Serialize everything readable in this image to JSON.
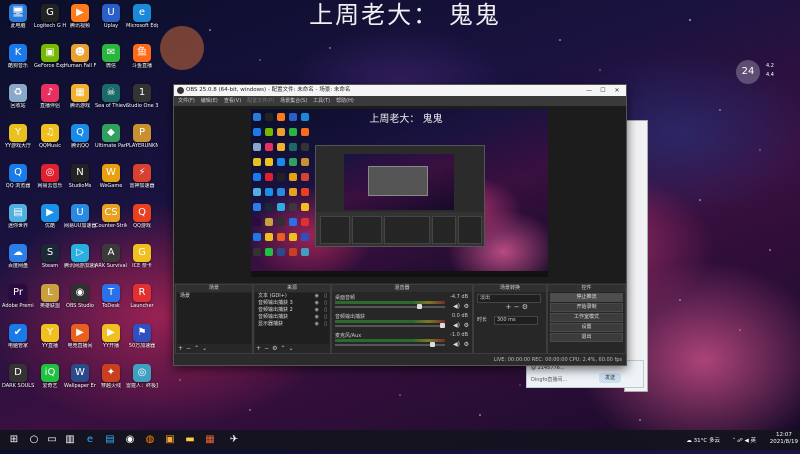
{
  "wallpaper_title": "上周老大： 鬼鬼",
  "desktop_icons": [
    {
      "label": "此电脑",
      "color": "#2a7ad8",
      "glyph": "🖥"
    },
    {
      "label": "Logitech G HUB",
      "color": "#222",
      "glyph": "G"
    },
    {
      "label": "腾讯视频",
      "color": "#ff7a1a",
      "glyph": "▶"
    },
    {
      "label": "Uplay",
      "color": "#2a5fc8",
      "glyph": "U"
    },
    {
      "label": "Microsoft Edge",
      "color": "#1a8ad8",
      "glyph": "e"
    },
    {
      "label": "酷狗音乐",
      "color": "#1a7ae8",
      "glyph": "K"
    },
    {
      "label": "GeForce Experience",
      "color": "#76b900",
      "glyph": "▣"
    },
    {
      "label": "Human Fall Flat",
      "color": "#e8a030",
      "glyph": "☻"
    },
    {
      "label": "微信",
      "color": "#2ab540",
      "glyph": "✉"
    },
    {
      "label": "斗鱼直播",
      "color": "#ff6a1a",
      "glyph": "鱼"
    },
    {
      "label": "回收站",
      "color": "#8aa8c8",
      "glyph": "♻"
    },
    {
      "label": "直播伴侣",
      "color": "#e83060",
      "glyph": "♪"
    },
    {
      "label": "腾讯游戏",
      "color": "#f0b030",
      "glyph": "▦"
    },
    {
      "label": "Sea of Thieves",
      "color": "#1a6a6a",
      "glyph": "☠"
    },
    {
      "label": "Studio One 3",
      "color": "#333",
      "glyph": "1"
    },
    {
      "label": "YY游戏大厅",
      "color": "#e8c020",
      "glyph": "Y"
    },
    {
      "label": "QQMusic",
      "color": "#f0c020",
      "glyph": "♫"
    },
    {
      "label": "腾讯QQ",
      "color": "#1a8ae8",
      "glyph": "Q"
    },
    {
      "label": "Ultimate Party",
      "color": "#30a060",
      "glyph": "◆"
    },
    {
      "label": "PLAYERUNKNOWN'S BATTLEGROUNDS",
      "color": "#c89030",
      "glyph": "P"
    },
    {
      "label": "QQ 浏览器",
      "color": "#1a7ae8",
      "glyph": "Q"
    },
    {
      "label": "网易云音乐",
      "color": "#e02030",
      "glyph": "◎"
    },
    {
      "label": "StudioMs",
      "color": "#222",
      "glyph": "N"
    },
    {
      "label": "WeGame",
      "color": "#e8a010",
      "glyph": "W"
    },
    {
      "label": "雷神加速器",
      "color": "#d84030",
      "glyph": "⚡"
    },
    {
      "label": "迷你世界",
      "color": "#50b0e0",
      "glyph": "▤"
    },
    {
      "label": "优酷",
      "color": "#1a90e8",
      "glyph": "▶"
    },
    {
      "label": "网易UU加速器",
      "color": "#2a8ae0",
      "glyph": "U"
    },
    {
      "label": "Counter-Strike Global Off",
      "color": "#e8a020",
      "glyph": "CS"
    },
    {
      "label": "QQ游戏",
      "color": "#e84020",
      "glyph": "Q"
    },
    {
      "label": "百度网盘",
      "color": "#2a80e8",
      "glyph": "☁"
    },
    {
      "label": "Steam",
      "color": "#1b2838",
      "glyph": "S"
    },
    {
      "label": "腾讯网游加速器",
      "color": "#2ab0e0",
      "glyph": "▷"
    },
    {
      "label": "ARK Survival Evolve",
      "color": "#3a3a3a",
      "glyph": "A"
    },
    {
      "label": "ICE 奈卡",
      "color": "#f0c020",
      "glyph": "G"
    },
    {
      "label": "Adobe Premiere",
      "color": "#2a0a40",
      "glyph": "Pr"
    },
    {
      "label": "英雄联盟",
      "color": "#c8a040",
      "glyph": "L"
    },
    {
      "label": "OBS Studio",
      "color": "#303030",
      "glyph": "◉"
    },
    {
      "label": "ToDesk",
      "color": "#2a70e8",
      "glyph": "T"
    },
    {
      "label": "Launcher",
      "color": "#e03030",
      "glyph": "R"
    },
    {
      "label": "电脑管家",
      "color": "#1a7ae8",
      "glyph": "✔"
    },
    {
      "label": "YY直播",
      "color": "#f0c020",
      "glyph": "Y"
    },
    {
      "label": "电竞直播间",
      "color": "#e86020",
      "glyph": "▶"
    },
    {
      "label": "YY开播",
      "color": "#f0c020",
      "glyph": "▶"
    },
    {
      "label": "50万加速器",
      "color": "#3050c0",
      "glyph": "⚑"
    },
    {
      "label": "DARK SOULS III",
      "color": "#333",
      "glyph": "D"
    },
    {
      "label": "爱奇艺",
      "color": "#20c040",
      "glyph": "iQ"
    },
    {
      "label": "Wallpaper Engine",
      "color": "#2a4a8a",
      "glyph": "W"
    },
    {
      "label": "穿越火线",
      "color": "#c84020",
      "glyph": "✦"
    },
    {
      "label": "雷霆人：终极直播",
      "color": "#40a0c0",
      "glyph": "◎"
    }
  ],
  "weather": {
    "temp": "24",
    "line1": "4.2",
    "line2": "4.4"
  },
  "chat_window": {
    "line1": "@ 2145776...",
    "line2": "Dingfo直播间...",
    "button": "发送"
  },
  "obs": {
    "title": "OBS 25.0.8 (64-bit, windows) - 配置文件: 未命名 - 场景: 未命名",
    "win_min": "—",
    "win_max": "☐",
    "win_close": "✕",
    "menu": [
      "文件(F)",
      "编辑(E)",
      "查看(V)",
      "配置文件(P)",
      "场景集合(S)",
      "工具(T)",
      "帮助(H)"
    ],
    "preview_title": "上周老大： 鬼鬼",
    "docks": {
      "scenes": {
        "header": "场景",
        "items": [
          "场景"
        ]
      },
      "sources": {
        "header": "来源",
        "items": [
          "文本 (GDI+)",
          "音频输出捕获 3",
          "音频输出捕获 2",
          "音频输出捕获",
          "显示器捕获"
        ]
      },
      "mixer": {
        "header": "混音器",
        "rows": [
          {
            "name": "桌面音频",
            "db": "-4.7 dB",
            "level": 0.78
          },
          {
            "name": "音频输出捕获",
            "db": "0.0 dB",
            "level": 1.0
          },
          {
            "name": "麦克风/Aux",
            "db": "-1.0 dB",
            "level": 0.9
          }
        ]
      },
      "transitions": {
        "header": "场景转换",
        "selected": "淡出",
        "duration_label": "时长",
        "duration_value": "300 ms"
      },
      "controls": {
        "header": "控件",
        "buttons": [
          "停止推流",
          "开始录制",
          "工作室模式",
          "设置",
          "退出"
        ]
      }
    },
    "statusbar": "LIVE: 00:00:00   REC: 00:00:00   CPU: 2.4%, 60.00 fps"
  },
  "taskbar": {
    "weather_temp": "31°C",
    "weather_text": "多云",
    "time": "12:07",
    "date": "2021/8/19",
    "ime": "英"
  }
}
